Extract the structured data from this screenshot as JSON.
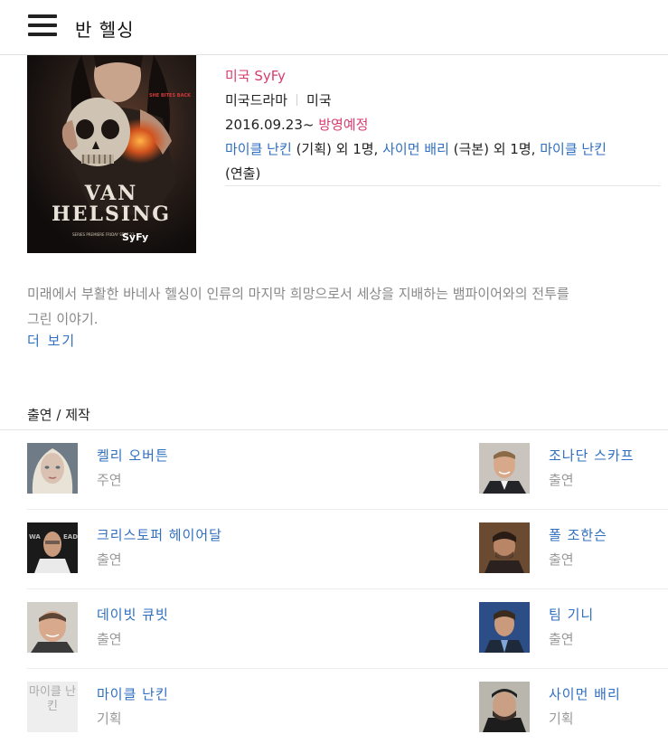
{
  "header": {
    "title": "반 헬싱"
  },
  "poster": {
    "tagline": "SHE BITES BACK",
    "title_line1": "VAN",
    "title_line2": "HELSING",
    "premiere": "SERIES PREMIERE FRIDAY SEPT 23",
    "network_logo": "SyFy"
  },
  "info": {
    "channel": "미국 SyFy",
    "genre": "미국드라마",
    "country": "미국",
    "date": "2016.09.23~",
    "status": "방영예정",
    "credits": [
      {
        "name": "마이클 난킨",
        "detail": "(기획) 외 1명,"
      },
      {
        "name": "사이먼 배리",
        "detail": "(극본) 외 1명,"
      },
      {
        "name": "마이클 난킨",
        "detail": ""
      }
    ],
    "credits_tail": "(연출)"
  },
  "synopsis": {
    "line1": "미래에서 부활한 바네사 헬싱이 인류의 마지막 희망으로서 세상을 지배하는 뱀파이어와의 전투를",
    "line2": "그린 이야기.",
    "more": "더 보기"
  },
  "cast_section": {
    "title": "출연 / 제작",
    "people": [
      {
        "name": "켈리 오버튼",
        "role": "주연"
      },
      {
        "name": "조나단 스카프",
        "role": "출연"
      },
      {
        "name": "크리스토퍼 헤이어달",
        "role": "출연"
      },
      {
        "name": "폴 조한슨",
        "role": "출연"
      },
      {
        "name": "데이빗 큐빗",
        "role": "출연"
      },
      {
        "name": "팀 기니",
        "role": "출연"
      },
      {
        "name": "마이클 난킨",
        "role": "기획",
        "placeholder": "마이클 난킨"
      },
      {
        "name": "사이먼 배리",
        "role": "기획"
      }
    ]
  }
}
